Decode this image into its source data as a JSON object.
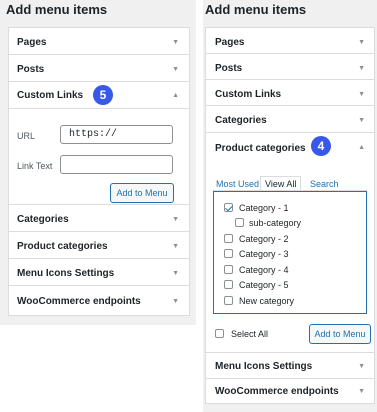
{
  "left": {
    "title": "Add menu items",
    "pages": "Pages",
    "posts": "Posts",
    "custom_links": {
      "label": "Custom Links",
      "badge": "5",
      "url_label": "URL",
      "url_value": "https://",
      "link_text_label": "Link Text",
      "link_text_value": "",
      "add_button": "Add to Menu"
    },
    "categories": "Categories",
    "product_categories": "Product categories",
    "menu_icons": "Menu Icons Settings",
    "woo_endpoints": "WooCommerce endpoints"
  },
  "right": {
    "title": "Add menu items",
    "pages": "Pages",
    "posts": "Posts",
    "custom_links": "Custom Links",
    "categories": "Categories",
    "product_categories": {
      "label": "Product categories",
      "badge": "4",
      "tabs": [
        "Most Used",
        "View All",
        "Search"
      ],
      "active_tab": "View All",
      "items": [
        {
          "label": "Category - 1",
          "checked": true,
          "indent": false
        },
        {
          "label": "sub-category",
          "checked": false,
          "indent": true
        },
        {
          "label": "Category - 2",
          "checked": false,
          "indent": false
        },
        {
          "label": "Category - 3",
          "checked": false,
          "indent": false
        },
        {
          "label": "Category - 4",
          "checked": false,
          "indent": false
        },
        {
          "label": "Category - 5",
          "checked": false,
          "indent": false
        },
        {
          "label": "New category",
          "checked": false,
          "indent": false
        }
      ],
      "select_all": "Select All",
      "add_button": "Add to Menu"
    },
    "menu_icons": "Menu Icons Settings",
    "woo_endpoints": "WooCommerce endpoints"
  },
  "colors": {
    "badge": "#3858e9",
    "link": "#2271b1",
    "panel_bg": "#f0f0f1",
    "border": "#dcdcde"
  },
  "icons": {
    "collapsed": "triangle-down-icon",
    "expanded": "triangle-up-icon"
  }
}
